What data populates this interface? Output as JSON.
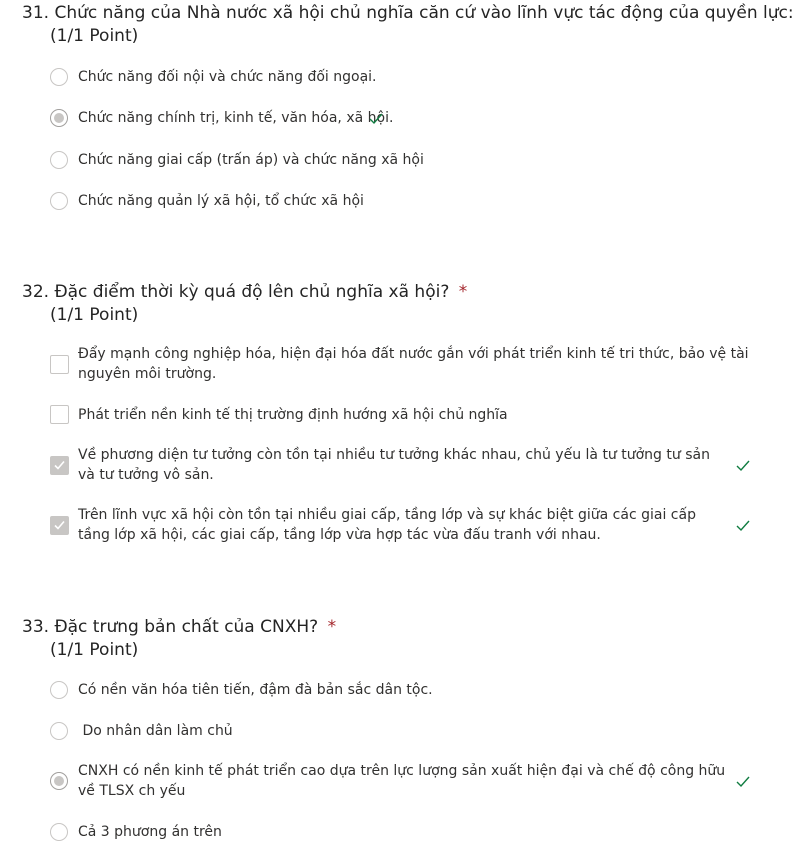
{
  "colors": {
    "required": "#a4262c",
    "correct": "#107c41",
    "control_border": "#c8c6c4"
  },
  "questions": [
    {
      "number": "31.",
      "text": "Chức năng của Nhà nước xã hội chủ nghĩa căn cứ vào lĩnh vực tác động của quyền lực:",
      "required": "*",
      "points": "(1/1 Point)",
      "type": "radio",
      "options": [
        {
          "label": "Chức năng đối nội và chức năng đối ngoại.",
          "checked": false,
          "correct": false
        },
        {
          "label": "Chức năng chính trị, kinh tế, văn hóa, xã hội.",
          "checked": true,
          "correct": true
        },
        {
          "label": "Chức năng giai cấp (trấn áp) và chức năng xã hội",
          "checked": false,
          "correct": false
        },
        {
          "label": "Chức năng quản lý xã hội, tổ chức xã hội",
          "checked": false,
          "correct": false
        }
      ]
    },
    {
      "number": "32.",
      "text": "Đặc điểm thời kỳ quá độ lên chủ nghĩa xã hội?",
      "required": "*",
      "points": "(1/1 Point)",
      "type": "checkbox",
      "options": [
        {
          "label": "Đẩy mạnh công nghiệp hóa, hiện đại hóa đất nước gắn với phát triển kinh tế tri thức, bảo vệ tài nguyên môi trường.",
          "checked": false,
          "correct": false
        },
        {
          "label": "Phát triển nền kinh tế thị trường định hướng xã hội chủ nghĩa",
          "checked": false,
          "correct": false
        },
        {
          "label": " Về phương diện tư tưởng còn tồn tại nhiều tư tưởng khác nhau, chủ yếu là tư tưởng tư sản và tư tưởng vô sản.",
          "checked": true,
          "correct": true
        },
        {
          "label": "Trên lĩnh vực xã hội còn tồn tại nhiều giai cấp, tầng lớp và sự khác biệt giữa các giai cấp tầng lớp xã hội, các giai cấp, tầng lớp vừa hợp tác vừa đấu tranh với nhau.",
          "checked": true,
          "correct": true
        }
      ]
    },
    {
      "number": "33.",
      "text": "Đặc trưng bản chất của CNXH?",
      "required": "*",
      "points": "(1/1 Point)",
      "type": "radio",
      "options": [
        {
          "label": "Có nền văn hóa tiên tiến, đậm đà bản sắc dân tộc.",
          "checked": false,
          "correct": false
        },
        {
          "label": " Do nhân dân làm chủ",
          "checked": false,
          "correct": false
        },
        {
          "label": "CNXH có nền kinh tế phát triển cao dựa trên lực lượng sản xuất hiện đại và chế độ công hữu về TLSX ch yếu",
          "checked": true,
          "correct": true
        },
        {
          "label": "Cả 3 phương án trên",
          "checked": false,
          "correct": false
        }
      ]
    }
  ]
}
